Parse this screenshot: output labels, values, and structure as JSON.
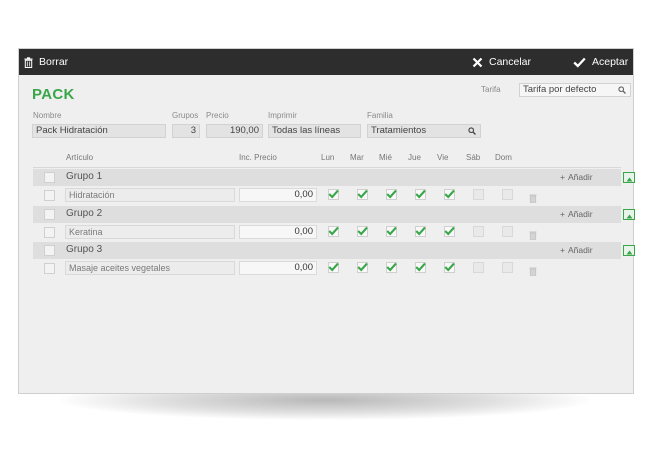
{
  "toolbar": {
    "delete_label": "Borrar",
    "cancel_label": "Cancelar",
    "accept_label": "Aceptar"
  },
  "form": {
    "title": "PACK",
    "tarifa_label": "Tarifa",
    "tarifa_value": "Tarifa por defecto",
    "nombre_label": "Nombre",
    "nombre_value": "Pack Hidratación",
    "grupos_label": "Grupos",
    "grupos_value": "3",
    "precio_label": "Precio",
    "precio_value": "190,00",
    "imprimir_label": "Imprimir",
    "imprimir_value": "Todas las líneas",
    "familia_label": "Familia",
    "familia_value": "Tratamientos"
  },
  "columns": {
    "articulo": "Artículo",
    "inc_precio": "Inc. Precio",
    "days": [
      "Lun",
      "Mar",
      "Mié",
      "Jue",
      "Vie",
      "Sáb",
      "Dom"
    ]
  },
  "add_label": "Añadir",
  "groups": [
    {
      "name": "Grupo 1",
      "item": "Hidratación",
      "price": "0,00",
      "days": [
        true,
        true,
        true,
        true,
        true,
        false,
        false
      ]
    },
    {
      "name": "Grupo 2",
      "item": "Keratina",
      "price": "0,00",
      "days": [
        true,
        true,
        true,
        true,
        true,
        false,
        false
      ]
    },
    {
      "name": "Grupo 3",
      "item": "Masaje aceites vegetales",
      "price": "0,00",
      "days": [
        true,
        true,
        true,
        true,
        true,
        false,
        false
      ]
    }
  ],
  "colors": {
    "accent": "#3aa64a",
    "toolbar_bg": "#2d2d2d"
  }
}
